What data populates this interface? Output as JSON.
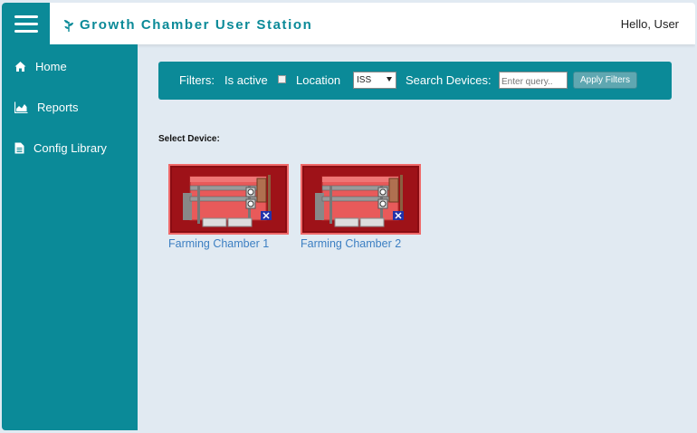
{
  "header": {
    "menu_icon": "hamburger-icon",
    "brand_icon": "sprout-icon",
    "title": "Growth Chamber User Station",
    "greeting": "Hello, User"
  },
  "sidebar": {
    "items": [
      {
        "label": "Home",
        "icon": "home-icon"
      },
      {
        "label": "Reports",
        "icon": "area-chart-icon"
      },
      {
        "label": "Config Library",
        "icon": "document-icon"
      }
    ]
  },
  "filters": {
    "prefix": "Filters:",
    "is_active_label": "Is active",
    "is_active_checked": false,
    "location_label": "Location",
    "location_value": "ISS",
    "search_label": "Search Devices:",
    "search_placeholder": "Enter query..",
    "search_value": "",
    "apply_label": "Apply Filters"
  },
  "main": {
    "select_title": "Select Device:",
    "devices": [
      {
        "name": "Farming Chamber 1"
      },
      {
        "name": "Farming Chamber 2"
      }
    ]
  },
  "colors": {
    "accent": "#0b8a98",
    "background": "#e1eaf2",
    "link": "#3c7fc2",
    "device_bg": "#8a0c12"
  }
}
